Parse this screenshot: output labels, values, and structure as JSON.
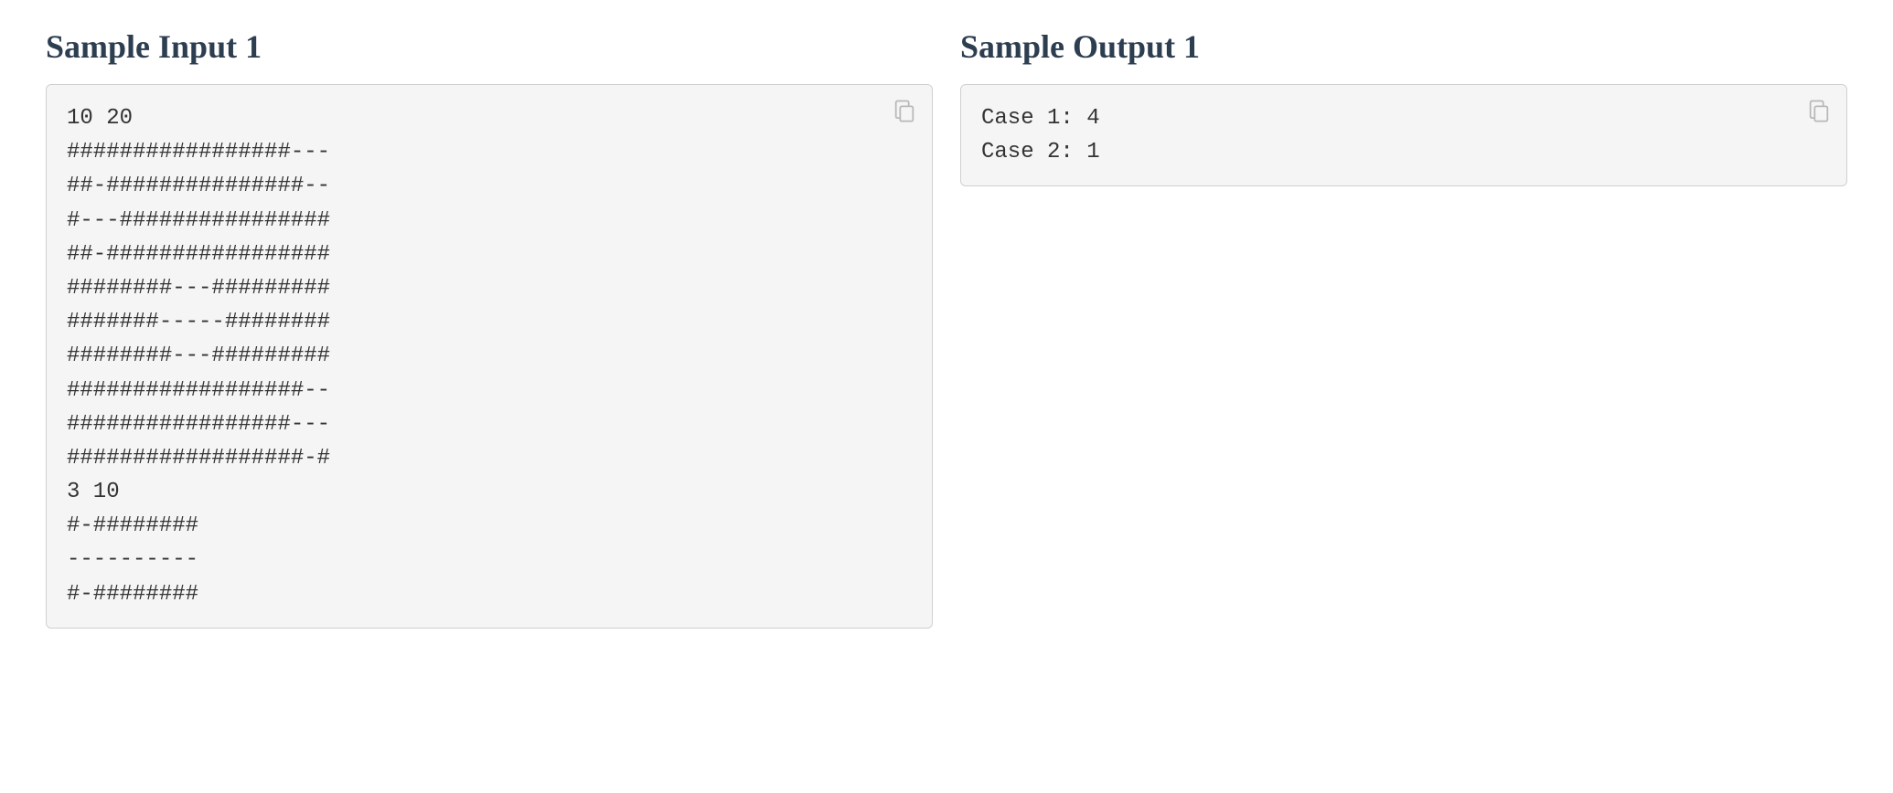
{
  "input": {
    "heading": "Sample Input 1",
    "text": "10 20\n#################---\n##-###############--\n#---################\n##-#################\n########---#########\n#######-----########\n########---#########\n##################--\n#################---\n##################-#\n3 10\n#-########\n----------\n#-########"
  },
  "output": {
    "heading": "Sample Output 1",
    "text": "Case 1: 4\nCase 2: 1"
  }
}
